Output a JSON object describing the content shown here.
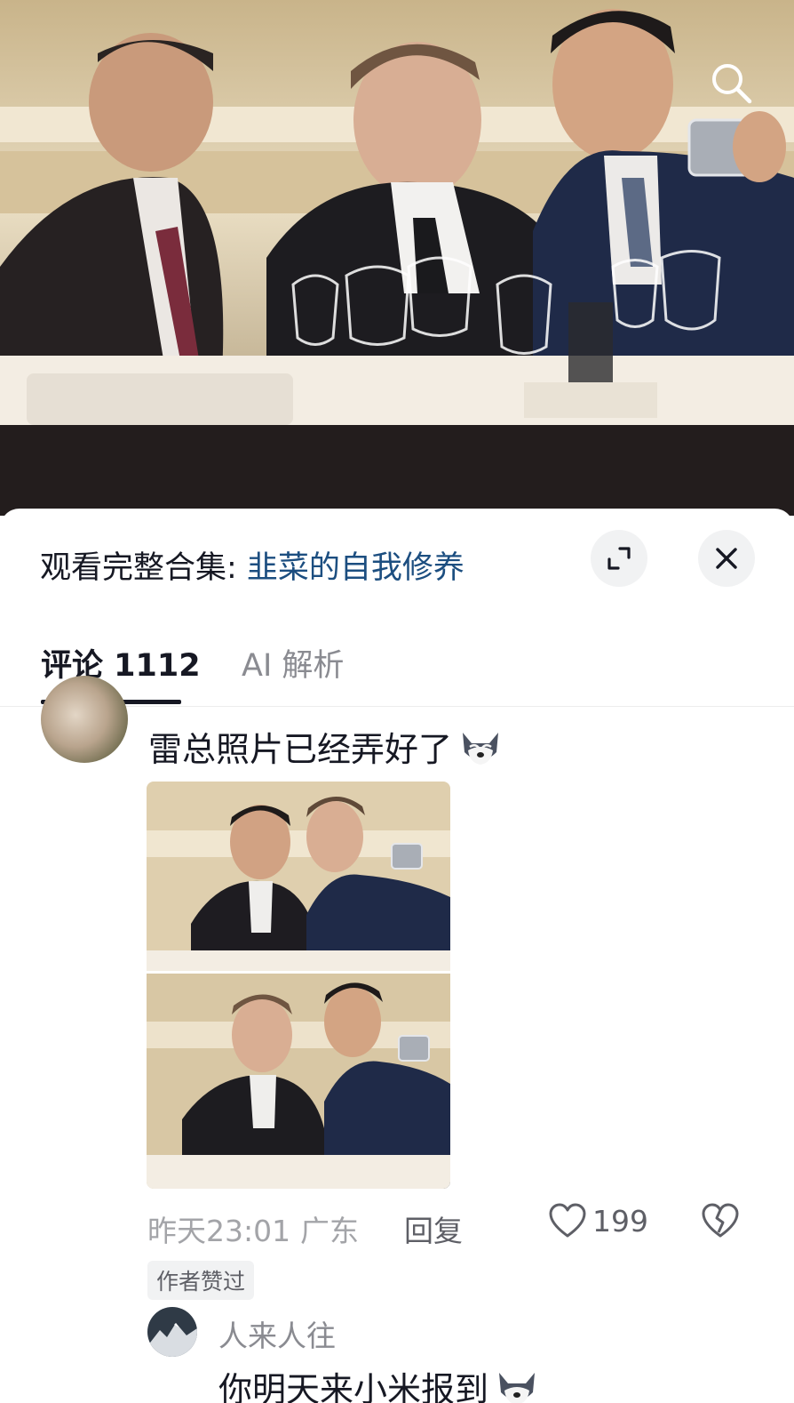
{
  "collection": {
    "prefix": "观看完整合集: ",
    "name": "韭菜的自我修养"
  },
  "tabs": [
    {
      "label": "评论 1112",
      "active": true
    },
    {
      "label": "AI 解析",
      "active": false
    }
  ],
  "comment": {
    "text": "雷总照片已经弄好了",
    "emoji": "husky-emoji",
    "time": "昨天23:01",
    "location": "广东",
    "reply_label": "回复",
    "likes": "199",
    "author_badge": "作者赞过"
  },
  "reply": {
    "username": "人来人往",
    "text": "你明天来小米报到",
    "emoji": "husky-emoji"
  },
  "colors": {
    "link": "#1c4e80",
    "text": "#161823",
    "muted": "#a3a4a8"
  },
  "icons": [
    "search-icon",
    "expand-icon",
    "close-icon",
    "heart-icon",
    "broken-heart-icon"
  ]
}
